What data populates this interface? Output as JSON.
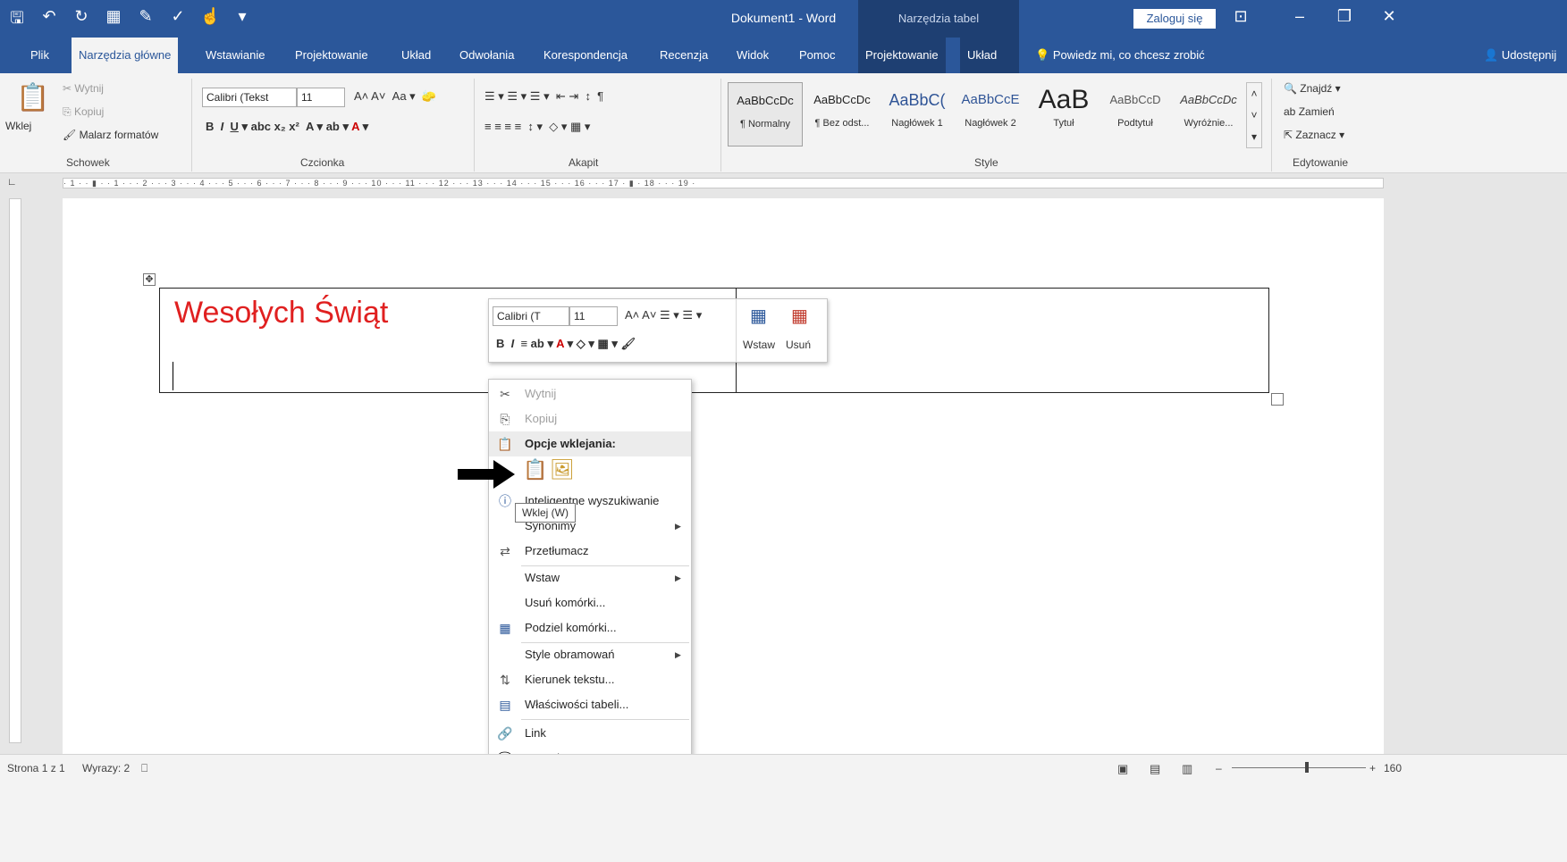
{
  "titlebar": {
    "doc_title": "Dokument1  -  Word",
    "tools_context": "Narzędzia tabel",
    "login": "Zaloguj się"
  },
  "tabs": [
    {
      "label": "Plik"
    },
    {
      "label": "Narzędzia główne"
    },
    {
      "label": "Wstawianie"
    },
    {
      "label": "Projektowanie"
    },
    {
      "label": "Układ"
    },
    {
      "label": "Odwołania"
    },
    {
      "label": "Korespondencja"
    },
    {
      "label": "Recenzja"
    },
    {
      "label": "Widok"
    },
    {
      "label": "Pomoc"
    },
    {
      "label": "Projektowanie"
    },
    {
      "label": "Układ"
    }
  ],
  "tell_me": "Powiedz mi, co chcesz zrobić",
  "share": "Udostępnij",
  "ribbon": {
    "clipboard": {
      "paste": "Wklej",
      "cut": "Wytnij",
      "copy": "Kopiuj",
      "format_painter": "Malarz formatów",
      "label": "Schowek"
    },
    "font": {
      "family": "Calibri (Tekst",
      "size": "11",
      "label": "Czcionka"
    },
    "paragraph": {
      "label": "Akapit"
    },
    "styles": {
      "label": "Style",
      "items": [
        {
          "preview": "AaBbCcDc",
          "name": "¶ Normalny"
        },
        {
          "preview": "AaBbCcDc",
          "name": "¶ Bez odst..."
        },
        {
          "preview": "AaBbC(",
          "name": "Nagłówek 1"
        },
        {
          "preview": "AaBbCcE",
          "name": "Nagłówek 2"
        },
        {
          "preview": "AaB",
          "name": "Tytuł"
        },
        {
          "preview": "AaBbCcD",
          "name": "Podtytuł"
        },
        {
          "preview": "AaBbCcDc",
          "name": "Wyróżnie..."
        }
      ]
    },
    "editing": {
      "find": "Znajdź",
      "replace": "Zamień",
      "select": "Zaznacz",
      "label": "Edytowanie"
    }
  },
  "ruler_text": "· 1 · · ▮ · · 1 · · · 2 · · · 3 · · · 4 · · · 5 · · · 6 · · · 7 · · · 8 · · · 9 · · · 10 · · · 11 · · · 12 · · · 13 · · · 14 · · · 15 · · · 16 · · · 17 · ▮ · 18 · · · 19 ·",
  "document": {
    "greeting": "Wesołych Świąt"
  },
  "mini_toolbar": {
    "font": "Calibri (T",
    "size": "11",
    "insert": "Wstaw",
    "delete": "Usuń"
  },
  "context_menu": {
    "cut": "Wytnij",
    "copy": "Kopiuj",
    "paste_options": "Opcje wklejania:",
    "smart_lookup": "Inteligentne wyszukiwanie",
    "synonyms": "Synonimy",
    "translate": "Przetłumacz",
    "insert": "Wstaw",
    "delete_cells": "Usuń komórki...",
    "split_cells": "Podziel komórki...",
    "border_styles": "Style obramowań",
    "text_direction": "Kierunek tekstu...",
    "table_properties": "Właściwości tabeli...",
    "link": "Link",
    "new_comment": "Nowy komentarz"
  },
  "tooltip": "Wklej (W)",
  "statusbar": {
    "page": "Strona 1 z 1",
    "words": "Wyrazy: 2",
    "zoom": "160"
  },
  "colors": {
    "brand": "#2b579a",
    "greeting": "#e02020"
  }
}
